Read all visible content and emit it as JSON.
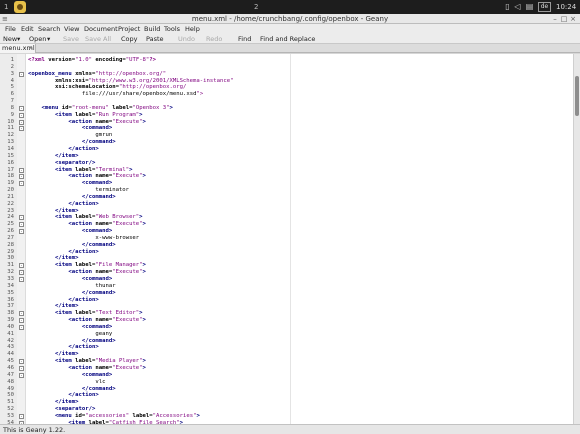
{
  "panel": {
    "workspace_left": "1",
    "workspace_right": "2",
    "keyboard_layout": "de",
    "clock": "10:24"
  },
  "window": {
    "title": "menu.xml - /home/crunchbang/.config/openbox - Geany",
    "menu_glyph": "≡",
    "minimize_glyph": "–",
    "maximize_glyph": "□",
    "close_glyph": "×"
  },
  "menubar": {
    "items": [
      "File",
      "Edit",
      "Search",
      "View",
      "Document",
      "Project",
      "Build",
      "Tools",
      "Help"
    ]
  },
  "toolbar": {
    "new_label": "New",
    "new_arrow": "▾",
    "open_label": "Open",
    "open_arrow": "▾",
    "save_label": "Save",
    "save_all_label": "Save All",
    "copy_label": "Copy",
    "paste_label": "Paste",
    "undo_label": "Undo",
    "redo_label": "Redo",
    "find_label": "Find",
    "find_replace_label": "Find and Replace"
  },
  "tabs": [
    {
      "label": "menu.xml",
      "close_glyph": "✕"
    }
  ],
  "editor": {
    "lines": [
      {
        "n": "1",
        "t": "<?xml version=\"1.0\" encoding=\"UTF-8\"?>",
        "f": ""
      },
      {
        "n": "2",
        "t": "",
        "f": ""
      },
      {
        "n": "3",
        "t": "<openbox_menu xmlns=\"http://openbox.org/\"",
        "f": "-"
      },
      {
        "n": "4",
        "t": "        xmlns:xsi=\"http://www.w3.org/2001/XMLSchema-instance\"",
        "f": ""
      },
      {
        "n": "5",
        "t": "        xsi:schemaLocation=\"http://openbox.org/",
        "f": ""
      },
      {
        "n": "6",
        "t": "                file:///usr/share/openbox/menu.xsd\">",
        "f": ""
      },
      {
        "n": "7",
        "t": "",
        "f": ""
      },
      {
        "n": "8",
        "t": "    <menu id=\"root-menu\" label=\"Openbox 3\">",
        "f": "-"
      },
      {
        "n": "9",
        "t": "        <item label=\"Run Program\">",
        "f": "-"
      },
      {
        "n": "10",
        "t": "            <action name=\"Execute\">",
        "f": "-"
      },
      {
        "n": "11",
        "t": "                <command>",
        "f": "-"
      },
      {
        "n": "12",
        "t": "                    gmrun",
        "f": ""
      },
      {
        "n": "13",
        "t": "                </command>",
        "f": ""
      },
      {
        "n": "14",
        "t": "            </action>",
        "f": ""
      },
      {
        "n": "15",
        "t": "        </item>",
        "f": ""
      },
      {
        "n": "16",
        "t": "        <separator/>",
        "f": ""
      },
      {
        "n": "17",
        "t": "        <item label=\"Terminal\">",
        "f": "-"
      },
      {
        "n": "18",
        "t": "            <action name=\"Execute\">",
        "f": "-"
      },
      {
        "n": "19",
        "t": "                <command>",
        "f": "-"
      },
      {
        "n": "20",
        "t": "                    terminator",
        "f": ""
      },
      {
        "n": "21",
        "t": "                </command>",
        "f": ""
      },
      {
        "n": "22",
        "t": "            </action>",
        "f": ""
      },
      {
        "n": "23",
        "t": "        </item>",
        "f": ""
      },
      {
        "n": "24",
        "t": "        <item label=\"Web Browser\">",
        "f": "-"
      },
      {
        "n": "25",
        "t": "            <action name=\"Execute\">",
        "f": "-"
      },
      {
        "n": "26",
        "t": "                <command>",
        "f": "-"
      },
      {
        "n": "27",
        "t": "                    x-www-browser",
        "f": ""
      },
      {
        "n": "28",
        "t": "                </command>",
        "f": ""
      },
      {
        "n": "29",
        "t": "            </action>",
        "f": ""
      },
      {
        "n": "30",
        "t": "        </item>",
        "f": ""
      },
      {
        "n": "31",
        "t": "        <item label=\"File Manager\">",
        "f": "-"
      },
      {
        "n": "32",
        "t": "            <action name=\"Execute\">",
        "f": "-"
      },
      {
        "n": "33",
        "t": "                <command>",
        "f": "-"
      },
      {
        "n": "34",
        "t": "                    thunar",
        "f": ""
      },
      {
        "n": "35",
        "t": "                </command>",
        "f": ""
      },
      {
        "n": "36",
        "t": "            </action>",
        "f": ""
      },
      {
        "n": "37",
        "t": "        </item>",
        "f": ""
      },
      {
        "n": "38",
        "t": "        <item label=\"Text Editor\">",
        "f": "-"
      },
      {
        "n": "39",
        "t": "            <action name=\"Execute\">",
        "f": "-"
      },
      {
        "n": "40",
        "t": "                <command>",
        "f": "-"
      },
      {
        "n": "41",
        "t": "                    geany",
        "f": ""
      },
      {
        "n": "42",
        "t": "                </command>",
        "f": ""
      },
      {
        "n": "43",
        "t": "            </action>",
        "f": ""
      },
      {
        "n": "44",
        "t": "        </item>",
        "f": ""
      },
      {
        "n": "45",
        "t": "        <item label=\"Media Player\">",
        "f": "-"
      },
      {
        "n": "46",
        "t": "            <action name=\"Execute\">",
        "f": "-"
      },
      {
        "n": "47",
        "t": "                <command>",
        "f": "-"
      },
      {
        "n": "48",
        "t": "                    vlc",
        "f": ""
      },
      {
        "n": "49",
        "t": "                </command>",
        "f": ""
      },
      {
        "n": "50",
        "t": "            </action>",
        "f": ""
      },
      {
        "n": "51",
        "t": "        </item>",
        "f": ""
      },
      {
        "n": "52",
        "t": "        <separator/>",
        "f": ""
      },
      {
        "n": "53",
        "t": "        <menu id=\"accessories\" label=\"Accessories\">",
        "f": "-"
      },
      {
        "n": "54",
        "t": "            <item label=\"Catfish File Search\">",
        "f": "-"
      }
    ]
  },
  "statusbar": {
    "text": "This is Geany 1.22."
  },
  "colors": {
    "panel_bg": "#1d1d1d",
    "tag": "#00007f",
    "attr_value": "#7f007f"
  }
}
